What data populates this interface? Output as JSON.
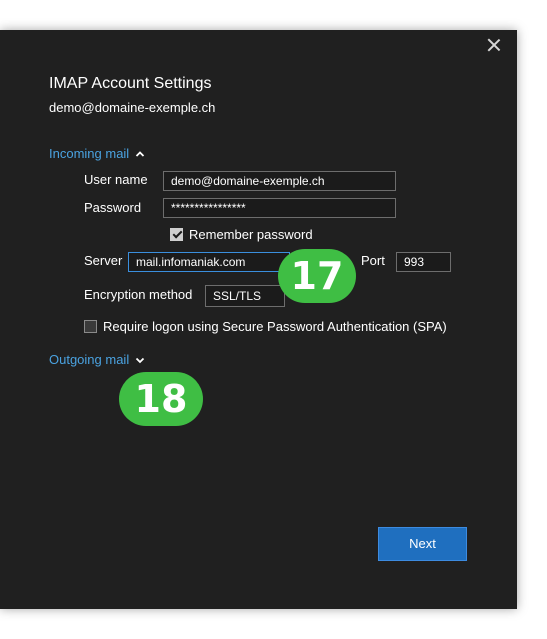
{
  "dialog": {
    "title": "IMAP Account Settings",
    "email": "demo@domaine-exemple.ch"
  },
  "incoming": {
    "section_label": "Incoming mail",
    "username_label": "User name",
    "username_value": "demo@domaine-exemple.ch",
    "password_label": "Password",
    "password_value": "****************",
    "remember_label": "Remember password",
    "remember_checked": true,
    "server_label": "Server",
    "server_value": "mail.infomaniak.com",
    "port_label": "Port",
    "port_value": "993",
    "encryption_label": "Encryption method",
    "encryption_value": "SSL/TLS",
    "spa_label": "Require logon using Secure Password Authentication (SPA)",
    "spa_checked": false
  },
  "outgoing": {
    "section_label": "Outgoing mail"
  },
  "annotations": {
    "badge_17": "17",
    "badge_18": "18"
  },
  "buttons": {
    "next_label": "Next"
  },
  "icons": {
    "close": "close-icon",
    "chevron_up": "chevron-up-icon",
    "chevron_down": "chevron-down-icon"
  },
  "colors": {
    "dialog_bg": "#202020",
    "link": "#4aa2e0",
    "accent": "#1f6fbf",
    "badge": "#3fbe44"
  }
}
